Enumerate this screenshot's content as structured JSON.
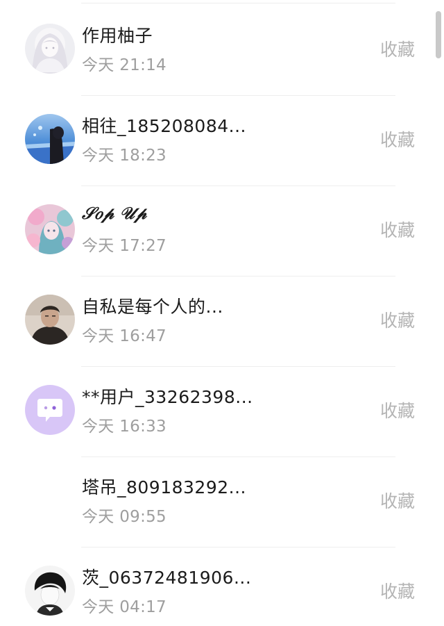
{
  "favorites": {
    "action_label": "收藏",
    "items": [
      {
        "name": "作用柚子",
        "time": "今天 21:14",
        "avatar": "avatar-anime-girl-white"
      },
      {
        "name": "相往_185208084...",
        "time": "今天 18:23",
        "avatar": "avatar-girl-blue-sky"
      },
      {
        "name": "𝒮𝑜𝓅 𝒰𝓅",
        "time": "今天 17:27",
        "avatar": "avatar-anime-pink-teal"
      },
      {
        "name": "自私是每个人的...",
        "time": "今天 16:47",
        "avatar": "avatar-man-portrait"
      },
      {
        "name": "**用户_33262398...",
        "time": "今天 16:33",
        "avatar": "avatar-default-chat-bubble"
      },
      {
        "name": "塔吊_809183292...",
        "time": "今天 09:55",
        "avatar": "avatar-blank"
      },
      {
        "name": "茨_06372481906...",
        "time": "今天 04:17",
        "avatar": "avatar-sketch-boy"
      }
    ]
  }
}
